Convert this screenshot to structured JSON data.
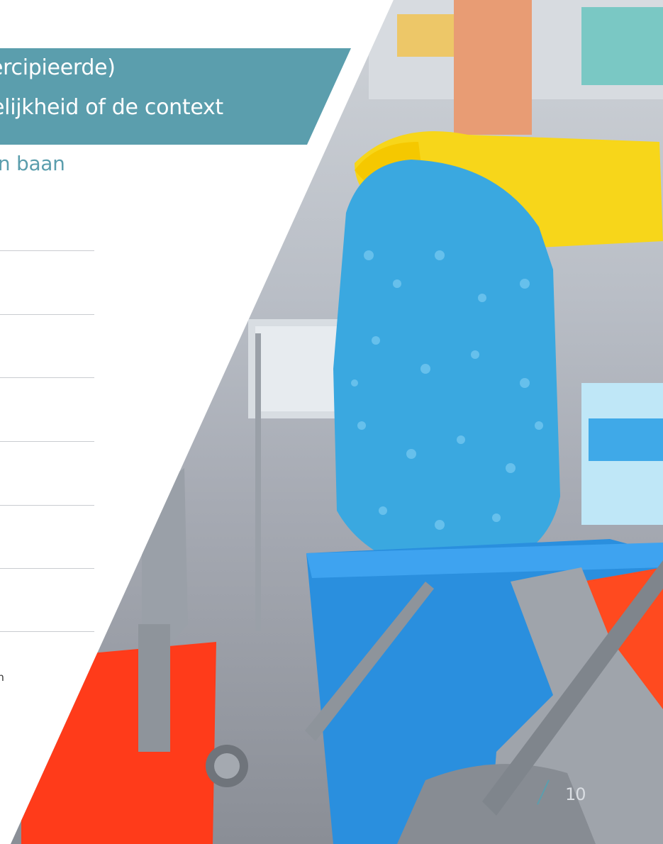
{
  "banner": {
    "line1": "ercipieerde)",
    "line2": "kelijkheid of de context"
  },
  "subheading": "en baan",
  "footnote": "oon",
  "page_number": "10",
  "colors": {
    "accent": "#5b9ead",
    "mop": "#3aa8e0",
    "bucket_blue": "#2a8fde",
    "bucket_red": "#ff3b1a",
    "glove": "#f7d61a"
  },
  "icons": {
    "photo": "cleaning-cart-photo"
  }
}
